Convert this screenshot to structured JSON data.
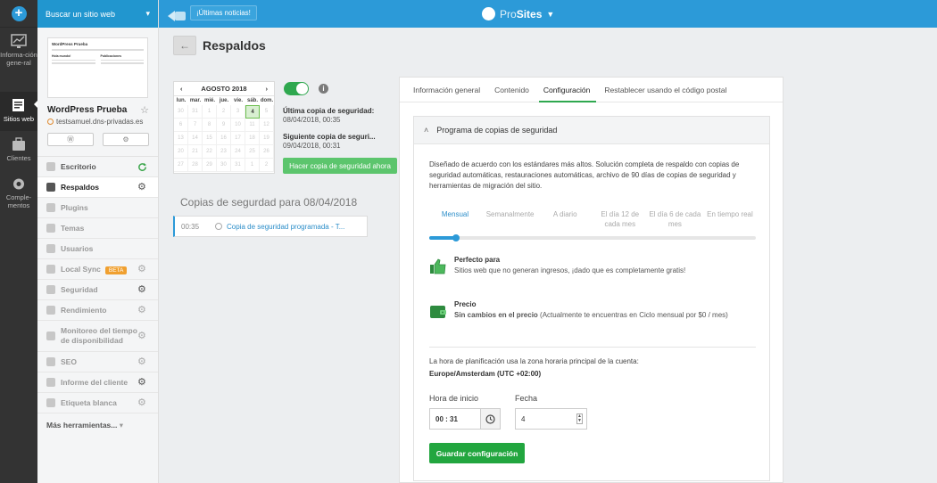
{
  "rail": {
    "items": [
      {
        "label": "Informa-ción gene-ral",
        "icon": "chart-icon"
      },
      {
        "label": "Sitios web",
        "icon": "sites-icon"
      },
      {
        "label": "Clientes",
        "icon": "clients-icon"
      },
      {
        "label": "Comple-mentos",
        "icon": "addons-icon"
      }
    ]
  },
  "sidebar": {
    "search_label": "Buscar un sitio web",
    "thumbnail": {
      "site_title": "WordPress Prueba",
      "col1": "Hola mundo!",
      "col2": "Publicaciones"
    },
    "site_name": "WordPress Prueba",
    "site_url": "testsamuel.dns-privadas.es",
    "menu": [
      {
        "label": "Escritorio",
        "icon": "dashboard-icon"
      },
      {
        "label": "Respaldos",
        "icon": "backup-icon"
      },
      {
        "label": "Plugins",
        "icon": "plugin-icon"
      },
      {
        "label": "Temas",
        "icon": "themes-icon"
      },
      {
        "label": "Usuarios",
        "icon": "users-icon"
      },
      {
        "label": "Local Sync",
        "badge": "BETA",
        "icon": "local-sync-icon"
      },
      {
        "label": "Seguridad",
        "icon": "security-icon"
      },
      {
        "label": "Rendimiento",
        "icon": "performance-icon"
      },
      {
        "label": "Monitoreo del tiempo de disponibilidad",
        "icon": "uptime-icon"
      },
      {
        "label": "SEO",
        "icon": "seo-icon"
      },
      {
        "label": "Informe del cliente",
        "icon": "report-icon"
      },
      {
        "label": "Etiqueta blanca",
        "icon": "whitelabel-icon"
      }
    ],
    "more_label": "Más herramientas..."
  },
  "topbar": {
    "news_label": "¡Últimas noticias!",
    "brand_pro": "Pro",
    "brand_sites": "Sites"
  },
  "page": {
    "title": "Respaldos"
  },
  "calendar": {
    "month": "AGOSTO 2018",
    "weekdays": [
      "lun.",
      "mar.",
      "mié.",
      "jue.",
      "vie.",
      "sáb.",
      "dom."
    ],
    "days": [
      "30",
      "31",
      "1",
      "2",
      "3",
      "4",
      "5",
      "6",
      "7",
      "8",
      "9",
      "10",
      "11",
      "12",
      "13",
      "14",
      "15",
      "16",
      "17",
      "18",
      "19",
      "20",
      "21",
      "22",
      "23",
      "24",
      "25",
      "26",
      "27",
      "28",
      "29",
      "30",
      "31",
      "1",
      "2"
    ],
    "selected_day": "4"
  },
  "backup": {
    "last_label": "Última copia de seguridad:",
    "last_value": "08/04/2018, 00:35",
    "next_label": "Siguiente copia de seguri...",
    "next_value": "09/04/2018, 00:31",
    "backup_now": "Hacer copia de seguridad ahora"
  },
  "copies": {
    "title": "Copias de segurdad para 08/04/2018",
    "rows": [
      {
        "time": "00:35",
        "label": "Copia de seguridad programada - T..."
      }
    ]
  },
  "tabs": [
    "Información general",
    "Contenido",
    "Configuración",
    "Restablecer usando el código postal"
  ],
  "schedule": {
    "header": "Programa de copias de seguridad",
    "description": "Diseñado de acuerdo con los estándares más altos. Solución completa de respaldo con copias de seguridad automáticas, restauraciones automáticas, archivo de 90 días de copias de seguridad y herramientas de migración del sitio.",
    "frequencies": [
      "Mensual",
      "Semanalmente",
      "A diario",
      "El día 12 de cada mes",
      "El día 6 de cada mes",
      "En tiempo real"
    ],
    "selected_frequency": "Mensual",
    "perfect_for_title": "Perfecto para",
    "perfect_for_text": "Sitios web que no generan ingresos, ¡dado que es completamente gratis!",
    "price_title": "Precio",
    "price_bold": "Sin cambios en el precio",
    "price_text": "(Actualmente te encuentras en Ciclo mensual por $0 / mes)",
    "timezone_text": "La hora de planificación usa la zona horaria principal de la cuenta:",
    "timezone_value": "Europe/Amsterdam (UTC +02:00)",
    "start_time_label": "Hora de inicio",
    "start_time_value": "00 : 31",
    "date_label": "Fecha",
    "date_value": "4",
    "save_label": "Guardar configuración"
  },
  "colors": {
    "topbar": "#2c9ad8",
    "accent_green": "#22a63f",
    "rail": "#333333"
  }
}
